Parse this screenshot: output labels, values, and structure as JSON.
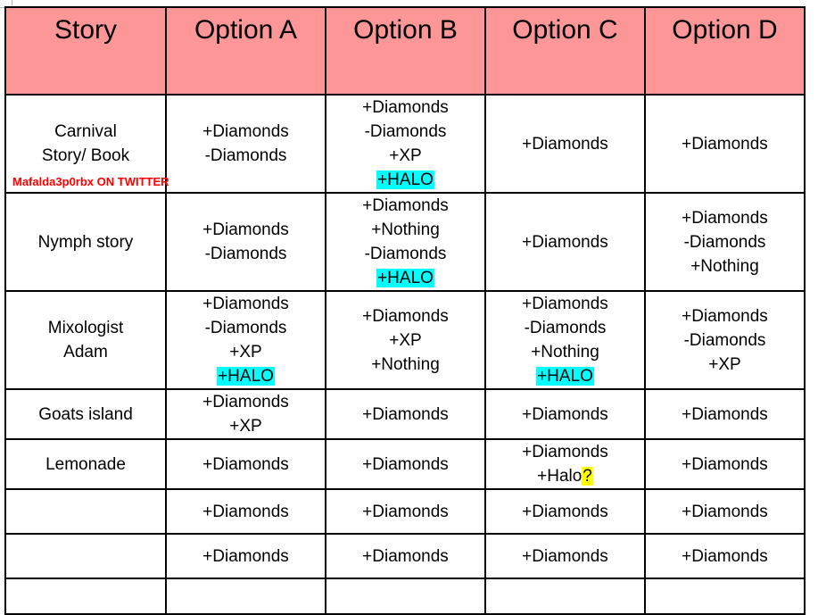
{
  "table": {
    "headers": [
      {
        "label": "Story"
      },
      {
        "label": "Option A"
      },
      {
        "label": "Option B"
      },
      {
        "label": "Option C"
      },
      {
        "label": "Option D"
      }
    ],
    "rows": [
      {
        "story": "Carnival\nStory/ Book",
        "story_line_1": "Carnival",
        "story_line_2": "Story/ Book",
        "watermark": "Mafalda3p0rbx ON TWITTER",
        "option_a": [
          "+Diamonds",
          "-Diamonds"
        ],
        "option_b": [
          "+Diamonds",
          "-Diamonds",
          "+XP",
          "+HALO"
        ],
        "option_b_highlight": "+HALO",
        "option_c": [
          "+Diamonds"
        ],
        "option_d": [
          "+Diamonds"
        ]
      },
      {
        "story": "Nymph story",
        "story_line_1": "Nymph story",
        "option_a": [
          "+Diamonds",
          "-Diamonds"
        ],
        "option_b": [
          "+Diamonds",
          "+Nothing",
          "-Diamonds",
          "+HALO"
        ],
        "option_b_highlight": "+HALO",
        "option_c": [
          "+Diamonds"
        ],
        "option_d": [
          "+Diamonds",
          "-Diamonds",
          "+Nothing"
        ]
      },
      {
        "story": "Mixologist\nAdam",
        "story_line_1": "Mixologist",
        "story_line_2": "Adam",
        "option_a": [
          "+Diamonds",
          "-Diamonds",
          "+XP",
          "+HALO"
        ],
        "option_a_highlight": "+HALO",
        "option_b": [
          "+Diamonds",
          "+XP",
          "+Nothing"
        ],
        "option_c": [
          "+Diamonds",
          "-Diamonds",
          "+Nothing",
          "+HALO"
        ],
        "option_c_highlight": "+HALO",
        "option_d": [
          "+Diamonds",
          "-Diamonds",
          "+XP"
        ]
      },
      {
        "story": "Goats island",
        "story_line_1": "Goats island",
        "option_a": [
          "+Diamonds",
          "+XP"
        ],
        "option_b": [
          "+Diamonds"
        ],
        "option_c": [
          "+Diamonds"
        ],
        "option_d": [
          "+Diamonds"
        ]
      },
      {
        "story": "Lemonade",
        "story_line_1": "Lemonade",
        "option_a": [
          "+Diamonds"
        ],
        "option_b": [
          "+Diamonds"
        ],
        "option_c": [
          "+Diamonds",
          "+Halo?"
        ],
        "option_c_halo_text": "+Halo",
        "option_c_halo_marker": "?",
        "option_d": [
          "+Diamonds"
        ]
      },
      {
        "story": "",
        "story_line_1": "",
        "option_a": [
          "+Diamonds"
        ],
        "option_b": [
          "+Diamonds"
        ],
        "option_c": [
          "+Diamonds"
        ],
        "option_d": [
          "+Diamonds"
        ]
      },
      {
        "story": "",
        "story_line_1": "",
        "option_a": [
          "+Diamonds"
        ],
        "option_b": [
          "+Diamonds"
        ],
        "option_c": [
          "+Diamonds"
        ],
        "option_d": [
          "+Diamonds"
        ]
      },
      {
        "story": "",
        "story_line_1": "",
        "option_a": [],
        "option_b": [],
        "option_c": [],
        "option_d": []
      }
    ]
  },
  "colors": {
    "header_background": "#FD9696",
    "halo_highlight": "#00FFFF",
    "question_highlight": "#FFFF00",
    "watermark_text": "#FF0000",
    "border": "#000000",
    "text": "#000000"
  }
}
